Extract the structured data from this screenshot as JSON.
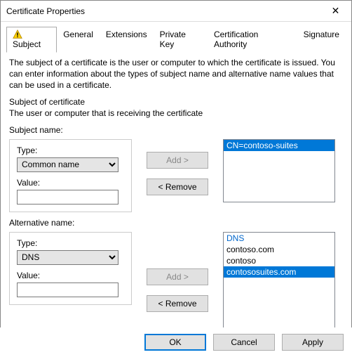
{
  "window": {
    "title": "Certificate Properties",
    "close_glyph": "✕"
  },
  "tabs": {
    "subject": "Subject",
    "general": "General",
    "extensions": "Extensions",
    "private_key": "Private Key",
    "cert_auth": "Certification Authority",
    "signature": "Signature"
  },
  "description": "The subject of a certificate is the user or computer to which the certificate is issued. You can enter information about the types of subject name and alternative name values that can be used in a certificate.",
  "subject": {
    "heading": "Subject of certificate",
    "sub": "The user or computer that is receiving the certificate",
    "name_label": "Subject name:",
    "type_label": "Type:",
    "type_value": "Common name",
    "value_label": "Value:",
    "value_value": "",
    "add_label": "Add >",
    "remove_label": "< Remove",
    "list": {
      "selected": "CN=contoso-suites"
    }
  },
  "altname": {
    "label": "Alternative name:",
    "type_label": "Type:",
    "type_value": "DNS",
    "value_label": "Value:",
    "value_value": "",
    "add_label": "Add >",
    "remove_label": "< Remove",
    "list": {
      "header": "DNS",
      "item0": "contoso.com",
      "item1": "contoso",
      "selected": "contososuites.com"
    },
    "scroll_left": "‹",
    "scroll_right": "›"
  },
  "buttons": {
    "ok": "OK",
    "cancel": "Cancel",
    "apply": "Apply"
  }
}
